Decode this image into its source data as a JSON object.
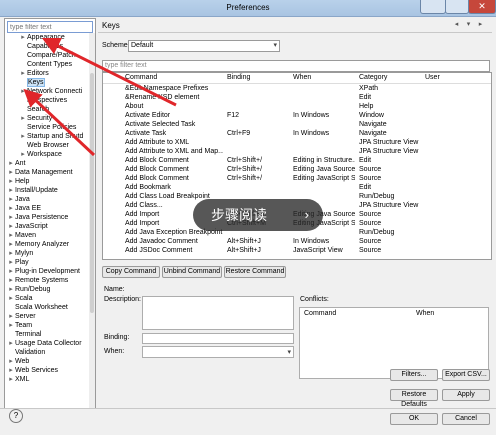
{
  "window": {
    "title": "Preferences"
  },
  "left": {
    "filter_placeholder": "type filter text",
    "tree": [
      {
        "label": "Appearance",
        "indent": 2,
        "twisty": "▸",
        "selected": false
      },
      {
        "label": "Capabilities",
        "indent": 2,
        "twisty": "",
        "selected": false
      },
      {
        "label": "Compare/Patch",
        "indent": 2,
        "twisty": "",
        "selected": false
      },
      {
        "label": "Content Types",
        "indent": 2,
        "twisty": "",
        "selected": false
      },
      {
        "label": "Editors",
        "indent": 2,
        "twisty": "▸",
        "selected": false
      },
      {
        "label": "Keys",
        "indent": 2,
        "twisty": "",
        "selected": true
      },
      {
        "label": "Network Connecti",
        "indent": 2,
        "twisty": "▸",
        "selected": false
      },
      {
        "label": "Perspectives",
        "indent": 2,
        "twisty": "",
        "selected": false
      },
      {
        "label": "Search",
        "indent": 2,
        "twisty": "",
        "selected": false
      },
      {
        "label": "Security",
        "indent": 2,
        "twisty": "▸",
        "selected": false
      },
      {
        "label": "Service Policies",
        "indent": 2,
        "twisty": "",
        "selected": false
      },
      {
        "label": "Startup and Shutd",
        "indent": 2,
        "twisty": "▸",
        "selected": false
      },
      {
        "label": "Web Browser",
        "indent": 2,
        "twisty": "",
        "selected": false
      },
      {
        "label": "Workspace",
        "indent": 2,
        "twisty": "▸",
        "selected": false
      },
      {
        "label": "Ant",
        "indent": 1,
        "twisty": "▸",
        "selected": false
      },
      {
        "label": "Data Management",
        "indent": 1,
        "twisty": "▸",
        "selected": false
      },
      {
        "label": "Help",
        "indent": 1,
        "twisty": "▸",
        "selected": false
      },
      {
        "label": "Install/Update",
        "indent": 1,
        "twisty": "▸",
        "selected": false
      },
      {
        "label": "Java",
        "indent": 1,
        "twisty": "▸",
        "selected": false
      },
      {
        "label": "Java EE",
        "indent": 1,
        "twisty": "▸",
        "selected": false
      },
      {
        "label": "Java Persistence",
        "indent": 1,
        "twisty": "▸",
        "selected": false
      },
      {
        "label": "JavaScript",
        "indent": 1,
        "twisty": "▸",
        "selected": false
      },
      {
        "label": "Maven",
        "indent": 1,
        "twisty": "▸",
        "selected": false
      },
      {
        "label": "Memory Analyzer",
        "indent": 1,
        "twisty": "▸",
        "selected": false
      },
      {
        "label": "Mylyn",
        "indent": 1,
        "twisty": "▸",
        "selected": false
      },
      {
        "label": "Play",
        "indent": 1,
        "twisty": "▸",
        "selected": false
      },
      {
        "label": "Plug-in Development",
        "indent": 1,
        "twisty": "▸",
        "selected": false
      },
      {
        "label": "Remote Systems",
        "indent": 1,
        "twisty": "▸",
        "selected": false
      },
      {
        "label": "Run/Debug",
        "indent": 1,
        "twisty": "▸",
        "selected": false
      },
      {
        "label": "Scala",
        "indent": 1,
        "twisty": "▸",
        "selected": false
      },
      {
        "label": "Scala Worksheet",
        "indent": 1,
        "twisty": "",
        "selected": false
      },
      {
        "label": "Server",
        "indent": 1,
        "twisty": "▸",
        "selected": false
      },
      {
        "label": "Team",
        "indent": 1,
        "twisty": "▸",
        "selected": false
      },
      {
        "label": "Terminal",
        "indent": 1,
        "twisty": "",
        "selected": false
      },
      {
        "label": "Usage Data Collector",
        "indent": 1,
        "twisty": "▸",
        "selected": false
      },
      {
        "label": "Validation",
        "indent": 1,
        "twisty": "",
        "selected": false
      },
      {
        "label": "Web",
        "indent": 1,
        "twisty": "▸",
        "selected": false
      },
      {
        "label": "Web Services",
        "indent": 1,
        "twisty": "▸",
        "selected": false
      },
      {
        "label": "XML",
        "indent": 1,
        "twisty": "▸",
        "selected": false
      }
    ]
  },
  "main": {
    "heading": "Keys",
    "scheme_label": "Scheme:",
    "scheme_value": "Default",
    "filter_placeholder": "type filter text",
    "columns": [
      "Command",
      "Binding",
      "When",
      "Category",
      "User"
    ],
    "rows": [
      [
        "&Edit Namespace Prefixes",
        "",
        "",
        "XPath",
        ""
      ],
      [
        "&Rename XSD element",
        "",
        "",
        "Edit",
        ""
      ],
      [
        "About",
        "",
        "",
        "Help",
        ""
      ],
      [
        "Activate Editor",
        "F12",
        "In Windows",
        "Window",
        ""
      ],
      [
        "Activate Selected Task",
        "",
        "",
        "Navigate",
        ""
      ],
      [
        "Activate Task",
        "Ctrl+F9",
        "In Windows",
        "Navigate",
        ""
      ],
      [
        "Add Attribute to XML",
        "",
        "",
        "JPA Structure View",
        ""
      ],
      [
        "Add Attribute to XML and Map...",
        "",
        "",
        "JPA Structure View",
        ""
      ],
      [
        "Add Block Comment",
        "Ctrl+Shift+/",
        "Editing in Structure...",
        "Edit",
        ""
      ],
      [
        "Add Block Comment",
        "Ctrl+Shift+/",
        "Editing Java Source",
        "Source",
        ""
      ],
      [
        "Add Block Comment",
        "Ctrl+Shift+/",
        "Editing JavaScript S...",
        "Source",
        ""
      ],
      [
        "Add Bookmark",
        "",
        "",
        "Edit",
        ""
      ],
      [
        "Add Class Load Breakpoint",
        "",
        "",
        "Run/Debug",
        ""
      ],
      [
        "Add Class...",
        "",
        "",
        "JPA Structure View",
        ""
      ],
      [
        "Add Import",
        "Ctrl+Shift+M",
        "Editing Java Source",
        "Source",
        ""
      ],
      [
        "Add Import",
        "Ctrl+Shift+M",
        "Editing JavaScript S...",
        "Source",
        ""
      ],
      [
        "Add Java Exception Breakpoint",
        "",
        "",
        "Run/Debug",
        ""
      ],
      [
        "Add Javadoc Comment",
        "Alt+Shift+J",
        "In Windows",
        "Source",
        ""
      ],
      [
        "Add JSDoc Comment",
        "Alt+Shift+J",
        "JavaScript View",
        "Source",
        ""
      ]
    ],
    "buttons": {
      "copy": "Copy Command",
      "unbind": "Unbind Command",
      "restore": "Restore Command"
    },
    "labels": {
      "name": "Name:",
      "description": "Description:",
      "binding": "Binding:",
      "when": "When:",
      "conflicts": "Conflicts:"
    },
    "conflicts_columns": [
      "Command",
      "When"
    ],
    "filters_button": "Filters...",
    "export_button": "Export CSV...",
    "restore_defaults": "Restore Defaults",
    "apply": "Apply",
    "ok": "OK",
    "cancel": "Cancel"
  },
  "overlay": {
    "text": "步骤阅读",
    "chevron": "›"
  },
  "colors": {
    "annotation_arrow": "#e0262a"
  }
}
